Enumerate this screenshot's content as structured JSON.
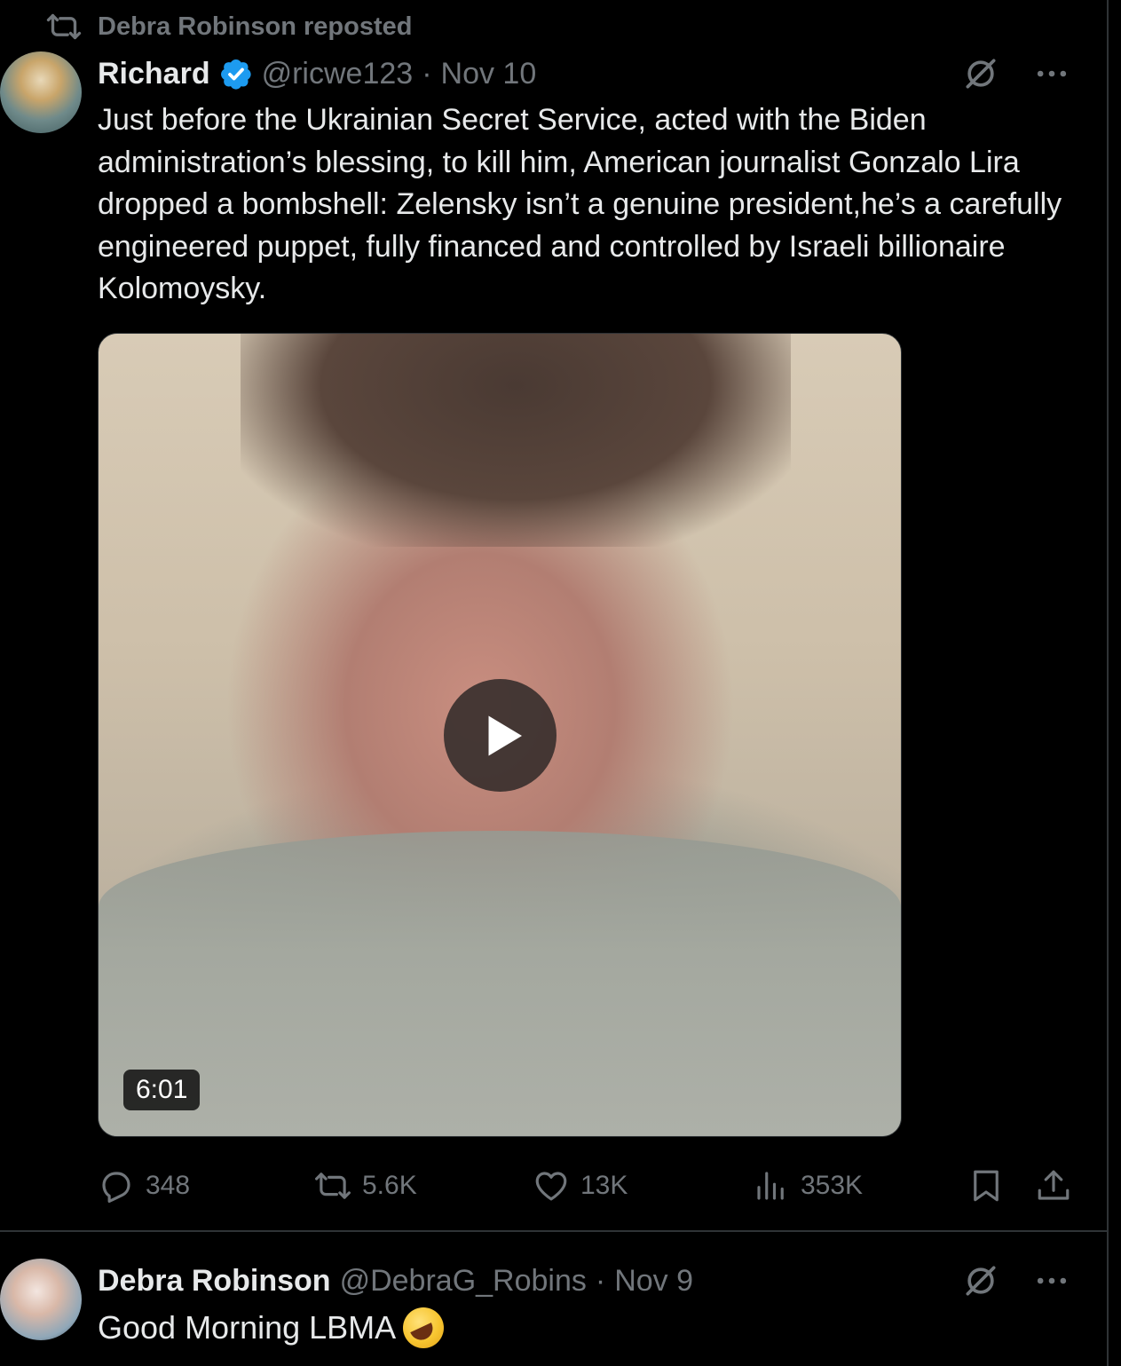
{
  "colors": {
    "background": "#000000",
    "text_primary": "#e7e9ea",
    "text_secondary": "#71767b",
    "verified_blue": "#1d9bf0",
    "divider": "#2f3336"
  },
  "posts": [
    {
      "repost_label": "Debra Robinson reposted",
      "author_name": "Richard",
      "verified": true,
      "handle": "@ricwe123",
      "separator": "·",
      "date": "Nov 10",
      "text": "Just before the Ukrainian Secret Service, acted with the Biden administration’s blessing, to kill him, American journalist Gonzalo Lira dropped a bombshell: Zelensky isn’t a genuine president,he’s a carefully engineered puppet, fully financed and controlled by Israeli billionaire Kolomoysky.",
      "media": {
        "type": "video",
        "duration": "6:01"
      },
      "stats": {
        "replies": "348",
        "reposts": "5.6K",
        "likes": "13K",
        "views": "353K"
      },
      "icons": [
        "repost-icon",
        "verified-badge-icon",
        "grok-icon",
        "more-icon",
        "play-icon",
        "reply-icon",
        "like-icon",
        "views-icon",
        "bookmark-icon",
        "share-icon"
      ]
    },
    {
      "author_name": "Debra Robinson",
      "handle": "@DebraG_Robins",
      "separator": "·",
      "date": "Nov 9",
      "text": "Good Morning LBMA",
      "emoji": "rolling-on-the-floor-laughing"
    }
  ]
}
